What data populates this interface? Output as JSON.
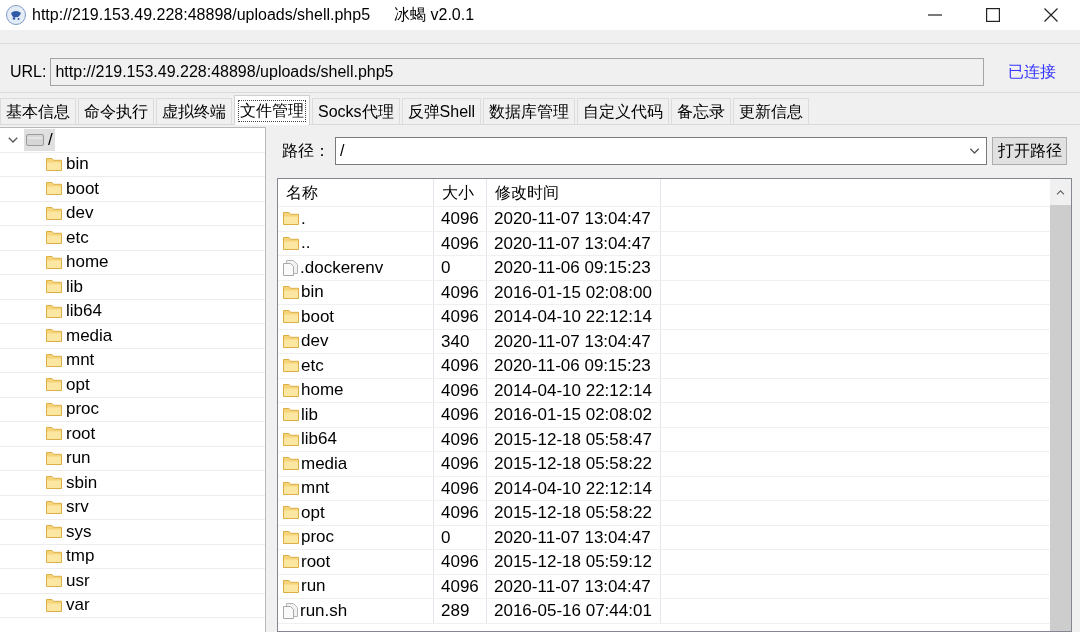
{
  "window": {
    "title": "http://219.153.49.228:48898/uploads/shell.php5",
    "app_label": "冰蝎 v2.0.1"
  },
  "url_bar": {
    "label": "URL:",
    "value": "http://219.153.49.228:48898/uploads/shell.php5",
    "status": "已连接"
  },
  "tabs": [
    {
      "label": "基本信息",
      "selected": false
    },
    {
      "label": "命令执行",
      "selected": false
    },
    {
      "label": "虚拟终端",
      "selected": false
    },
    {
      "label": "文件管理",
      "selected": true
    },
    {
      "label": "Socks代理",
      "selected": false
    },
    {
      "label": "反弹Shell",
      "selected": false
    },
    {
      "label": "数据库管理",
      "selected": false
    },
    {
      "label": "自定义代码",
      "selected": false
    },
    {
      "label": "备忘录",
      "selected": false
    },
    {
      "label": "更新信息",
      "selected": false
    }
  ],
  "tree": {
    "label": "/",
    "expanded": true,
    "selected": true,
    "children": [
      {
        "label": "bin",
        "selected": false
      },
      {
        "label": "boot",
        "selected": false
      },
      {
        "label": "dev",
        "selected": false
      },
      {
        "label": "etc",
        "selected": false
      },
      {
        "label": "home",
        "selected": false
      },
      {
        "label": "lib",
        "selected": false
      },
      {
        "label": "lib64",
        "selected": false
      },
      {
        "label": "media",
        "selected": false
      },
      {
        "label": "mnt",
        "selected": false
      },
      {
        "label": "opt",
        "selected": false
      },
      {
        "label": "proc",
        "selected": false
      },
      {
        "label": "root",
        "selected": false
      },
      {
        "label": "run",
        "selected": false
      },
      {
        "label": "sbin",
        "selected": false
      },
      {
        "label": "srv",
        "selected": false
      },
      {
        "label": "sys",
        "selected": false
      },
      {
        "label": "tmp",
        "selected": false
      },
      {
        "label": "usr",
        "selected": false
      },
      {
        "label": "var",
        "selected": false
      }
    ]
  },
  "path_bar": {
    "label": "路径：",
    "value": "/",
    "button": "打开路径"
  },
  "table": {
    "columns": [
      "名称",
      "大小",
      "修改时间"
    ],
    "rows": [
      {
        "kind": "folder",
        "name": ".",
        "size": "4096",
        "modified": "2020-11-07 13:04:47"
      },
      {
        "kind": "folder",
        "name": "..",
        "size": "4096",
        "modified": "2020-11-07 13:04:47"
      },
      {
        "kind": "file",
        "name": ".dockerenv",
        "size": "0",
        "modified": "2020-11-06 09:15:23"
      },
      {
        "kind": "folder",
        "name": "bin",
        "size": "4096",
        "modified": "2016-01-15 02:08:00"
      },
      {
        "kind": "folder",
        "name": "boot",
        "size": "4096",
        "modified": "2014-04-10 22:12:14"
      },
      {
        "kind": "folder",
        "name": "dev",
        "size": "340",
        "modified": "2020-11-07 13:04:47"
      },
      {
        "kind": "folder",
        "name": "etc",
        "size": "4096",
        "modified": "2020-11-06 09:15:23"
      },
      {
        "kind": "folder",
        "name": "home",
        "size": "4096",
        "modified": "2014-04-10 22:12:14"
      },
      {
        "kind": "folder",
        "name": "lib",
        "size": "4096",
        "modified": "2016-01-15 02:08:02"
      },
      {
        "kind": "folder",
        "name": "lib64",
        "size": "4096",
        "modified": "2015-12-18 05:58:47"
      },
      {
        "kind": "folder",
        "name": "media",
        "size": "4096",
        "modified": "2015-12-18 05:58:22"
      },
      {
        "kind": "folder",
        "name": "mnt",
        "size": "4096",
        "modified": "2014-04-10 22:12:14"
      },
      {
        "kind": "folder",
        "name": "opt",
        "size": "4096",
        "modified": "2015-12-18 05:58:22"
      },
      {
        "kind": "folder",
        "name": "proc",
        "size": "0",
        "modified": "2020-11-07 13:04:47"
      },
      {
        "kind": "folder",
        "name": "root",
        "size": "4096",
        "modified": "2015-12-18 05:59:12"
      },
      {
        "kind": "folder",
        "name": "run",
        "size": "4096",
        "modified": "2020-11-07 13:04:47"
      },
      {
        "kind": "file",
        "name": "run.sh",
        "size": "289",
        "modified": "2016-05-16 07:44:01"
      }
    ]
  }
}
